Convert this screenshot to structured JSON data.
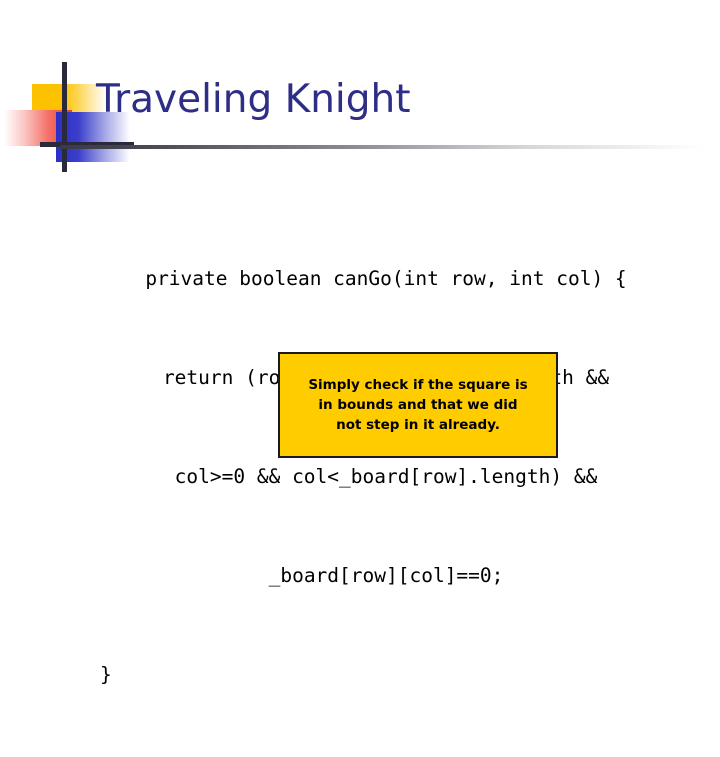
{
  "slide": {
    "title": "Traveling Knight",
    "title_color": "#2E2E86",
    "background_color": "#ffffff"
  },
  "logo": {
    "square_yellow_color": "#FCC200",
    "square_red_color": "#F03C32",
    "square_blue_color": "#2B2FC4",
    "line_color": "#2A2A3C"
  },
  "code": {
    "language": "java",
    "lines": [
      "private boolean canGo(int row, int col) {",
      "return (row>=0 && row<_board.length &&",
      "col>=0 && col<_board[row].length) &&",
      "_board[row][col]==0;",
      "}"
    ]
  },
  "callout": {
    "text": "Simply check if the square is\nin bounds and that we did\nnot step in it already.",
    "background_color": "#FFCC00",
    "border_color": "#1A1A1A",
    "text_color": "#000000"
  }
}
